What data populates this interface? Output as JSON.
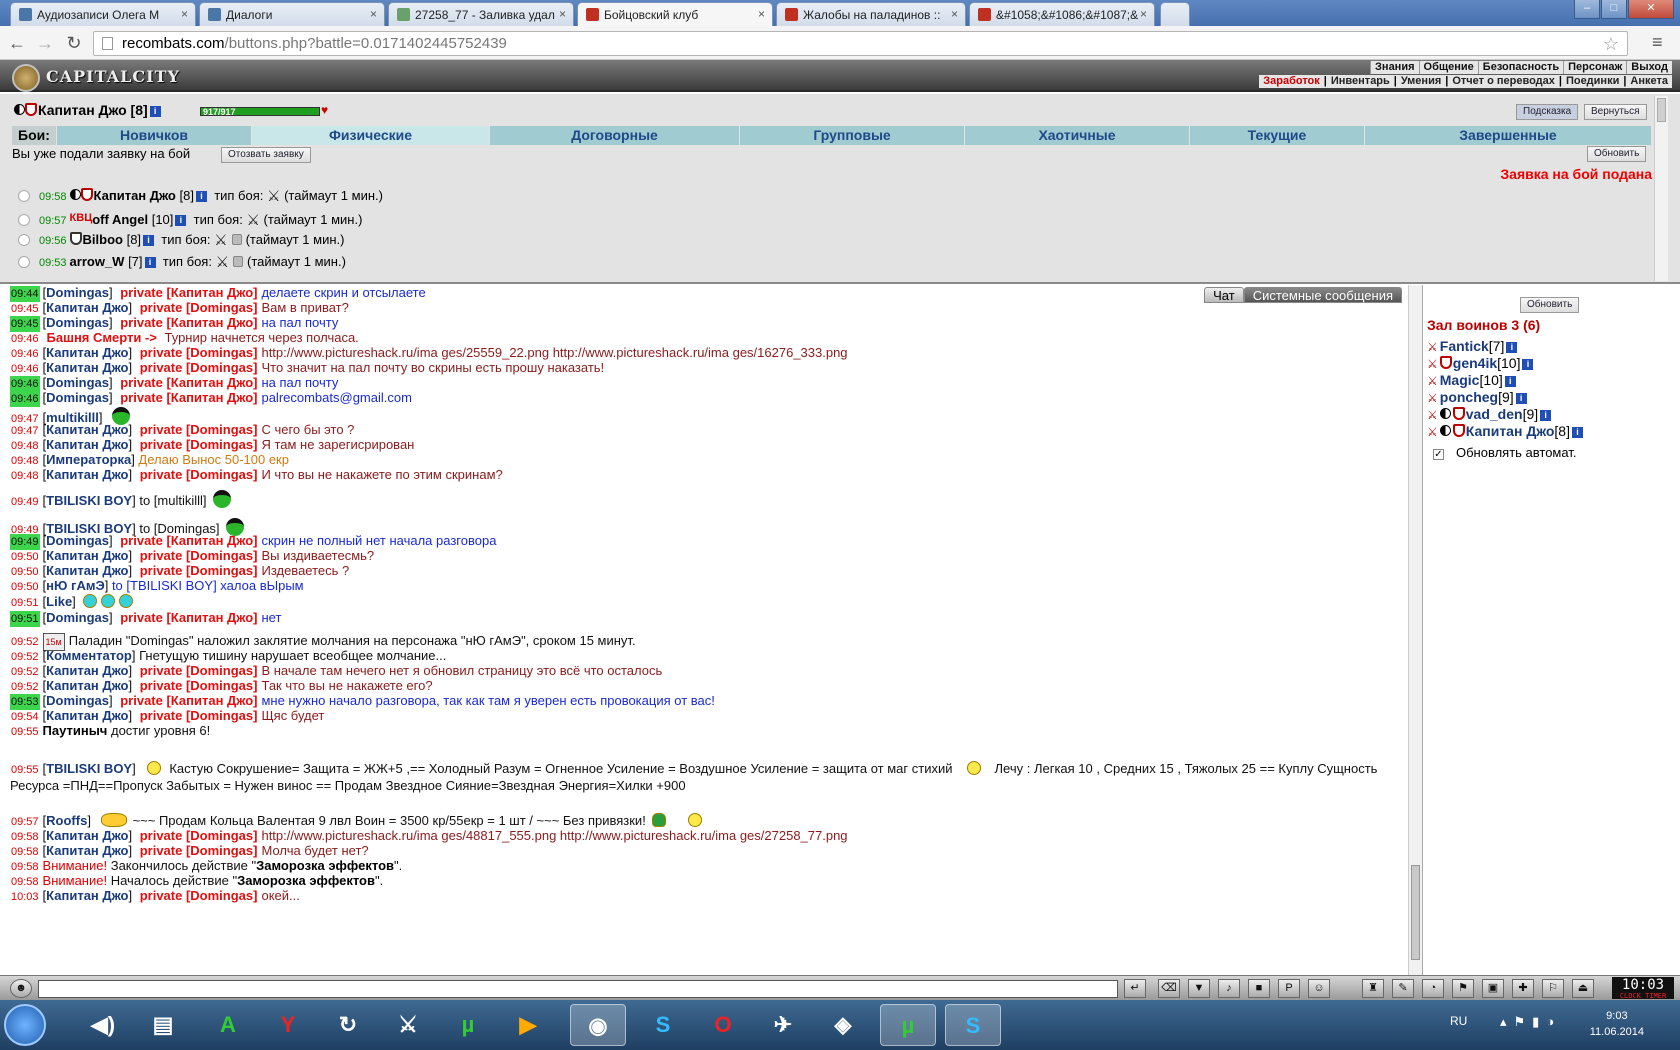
{
  "browser": {
    "tabs": [
      {
        "title": "Аудиозаписи Олега М",
        "color": "#4a76a8"
      },
      {
        "title": "Диалоги",
        "color": "#4a76a8"
      },
      {
        "title": "27258_77 - Заливка удал",
        "color": "#6aa06a"
      },
      {
        "title": "Бойцовский клуб",
        "color": "#c03020"
      },
      {
        "title": "Жалобы на паладинов ::",
        "color": "#c03020"
      },
      {
        "title": "&#1058;&#1086;&#1087;&",
        "color": "#c03020"
      }
    ],
    "url_host": "recombats.com",
    "url_path": "/buttons.php?battle=0.0171402445752439",
    "window_icons": [
      "minimize-icon",
      "maximize-icon",
      "close-icon"
    ]
  },
  "game": {
    "logo": "CAPITALCITY",
    "top_menu": [
      "Знания",
      "Общение",
      "Безопасность",
      "Персонаж",
      "Выход"
    ],
    "sub_menu": [
      "Заработок",
      "Инвентарь",
      "Умения",
      "Отчет о переводах",
      "Поединки",
      "Анкета"
    ],
    "character": {
      "name": "Капитан Джо",
      "level": "[8]",
      "hp": "917/917",
      "hp_fraction": 1.0
    },
    "hint_btn": "Подсказка",
    "back_btn": "Вернуться",
    "battles_label": "Бои:",
    "battle_tabs": [
      "Новичков",
      "Физические",
      "Договорные",
      "Групповые",
      "Хаотичные",
      "Текущие",
      "Завершенные"
    ],
    "applied_msg": "Вы уже подали заявку на бой",
    "withdraw_btn": "Отозвать заявку",
    "refresh_btn": "Обновить",
    "applied_red": "Заявка на бой подана",
    "bids": [
      {
        "time": "09:58",
        "name": "Капитан Джо",
        "level": "[8]",
        "type_label": "тип боя:",
        "timeout": "(таймаут 1 мин.)"
      },
      {
        "time": "09:57",
        "name": "off Angel",
        "level": "[10]",
        "badge": "КВЦ",
        "type_label": "тип боя:",
        "timeout": "(таймаут 1 мин.)"
      },
      {
        "time": "09:56",
        "name": "Bilboo",
        "level": "[8]",
        "type_label": "тип боя:",
        "timeout": "(таймаут 1 мин.)"
      },
      {
        "time": "09:53",
        "name": "arrow_W",
        "level": "[7]",
        "type_label": "тип боя:",
        "timeout": "(таймаут 1 мин.)"
      }
    ]
  },
  "chat": {
    "tabs": [
      "Чат",
      "Системные сообщения"
    ],
    "lines": [
      {
        "ts": "09:44",
        "g": true,
        "nick": "Domingas",
        "priv": "private [Капитан Джо]",
        "msg": "делаете скрин и отсылаете",
        "mc": "b"
      },
      {
        "ts": "09:45",
        "nick": "Капитан Джо",
        "priv": "private [Domingas]",
        "msg": "Вам в приват?",
        "mc": "r"
      },
      {
        "ts": "09:45",
        "g": true,
        "nick": "Domingas",
        "priv": "private [Капитан Джо]",
        "msg": "на пал почту",
        "mc": "b"
      },
      {
        "ts": "09:46",
        "sys": "Башня Смерти -> ",
        "msg": "Турнир начнется через полчаса.",
        "mc": "r"
      },
      {
        "ts": "09:46",
        "nick": "Капитан Джо",
        "priv": "private [Domingas]",
        "msg": "http://www.pictureshack.ru/ima ges/25559_22.png http://www.pictureshack.ru/ima ges/16276_333.png",
        "mc": "r"
      },
      {
        "ts": "09:46",
        "nick": "Капитан Джо",
        "priv": "private [Domingas]",
        "msg": "Что значит на пал почту во скрины есть прошу наказать!",
        "mc": "r"
      },
      {
        "ts": "09:46",
        "g": true,
        "nick": "Domingas",
        "priv": "private [Капитан Джо]",
        "msg": "на пал почту",
        "mc": "b"
      },
      {
        "ts": "09:46",
        "g": true,
        "nick": "Domingas",
        "priv": "private [Капитан Джо]",
        "msg": "palrecombats@gmail.com",
        "mc": "b"
      },
      {
        "ts": "09:47",
        "nick": "multikilll",
        "msg": "",
        "mc": "k",
        "hat": true
      },
      {
        "ts": "09:47",
        "nick": "Капитан Джо",
        "priv": "private [Domingas]",
        "msg": "С чего бы это ?",
        "mc": "r"
      },
      {
        "ts": "09:48",
        "nick": "Капитан Джо",
        "priv": "private [Domingas]",
        "msg": "Я там не зарегисрирован",
        "mc": "r"
      },
      {
        "ts": "09:48",
        "nick": "Императорка",
        "msg": "Делаю Вынос 50-100 екр",
        "mc": "o"
      },
      {
        "ts": "09:48",
        "nick": "Капитан Джо",
        "priv": "private [Domingas]",
        "msg": "И что вы не накажете по этим скринам?",
        "mc": "r"
      },
      {
        "ts": "09:49",
        "nick": "TBILISKI BOY",
        "msg": "to [multikilll]",
        "mc": "k",
        "hat": true
      },
      {
        "ts": "09:49",
        "nick": "TBILISKI BOY",
        "msg": "to [Domingas]",
        "mc": "k",
        "hat": true
      },
      {
        "ts": "09:49",
        "g": true,
        "nick": "Domingas",
        "priv": "private [Капитан Джо]",
        "msg": "скрин не полный нет начала разговора",
        "mc": "b"
      },
      {
        "ts": "09:50",
        "nick": "Капитан Джо",
        "priv": "private [Domingas]",
        "msg": "Вы издиваетесмь?",
        "mc": "r"
      },
      {
        "ts": "09:50",
        "nick": "Капитан Джо",
        "priv": "private [Domingas]",
        "msg": "Издеваетесь ?",
        "mc": "r"
      },
      {
        "ts": "09:50",
        "nick": "нЮ гАмЭ",
        "msg": "to [TBILISKI BOY] халоа вЫрым",
        "mc": "b"
      },
      {
        "ts": "09:51",
        "nick": "Like",
        "msg": "",
        "mc": "k",
        "smiles": 3
      },
      {
        "ts": "09:51",
        "g": true,
        "nick": "Domingas",
        "priv": "private [Капитан Джо]",
        "msg": "нет",
        "mc": "b"
      },
      {
        "ts": "09:52",
        "sysmsg": "Паладин \"Domingas\" наложил заклятие молчания на персонажа \"нЮ гАмЭ\", сроком 15 минут.",
        "silence": "15м"
      },
      {
        "ts": "09:52",
        "nick": "Комментатор",
        "msg": "Гнетущую тишину нарушает всеобщее молчание...",
        "mc": "k"
      },
      {
        "ts": "09:52",
        "nick": "Капитан Джо",
        "priv": "private [Domingas]",
        "msg": "В начале там нечего нет я обновил страницу это всё что осталось",
        "mc": "r"
      },
      {
        "ts": "09:52",
        "nick": "Капитан Джо",
        "priv": "private [Domingas]",
        "msg": "Так что вы не накажете его?",
        "mc": "r"
      },
      {
        "ts": "09:53",
        "g": true,
        "nick": "Domingas",
        "priv": "private [Капитан Джо]",
        "msg": "мне нужно начало разговора, так как там я уверен есть провокация от вас!",
        "mc": "b"
      },
      {
        "ts": "09:54",
        "nick": "Капитан Джо",
        "priv": "private [Domingas]",
        "msg": "Щяс будет",
        "mc": "r"
      },
      {
        "ts": "09:55",
        "plain_nick": "Паутиныч",
        "msg": "достиг уровня 6!",
        "mc": "k"
      },
      {
        "ts": "09:55",
        "nick": "TBILISKI BOY",
        "msg": "Кастую Сокрушение= Защита = ЖЖ+5 ,== Холодный Разум = Огненное Усиление = Воздушное Усиление = защита от маг стихий",
        "msg2": "Лечу : Легкая 10 , Средних 15 , Тяжолых 25 == Куплу Сущность Ресурса =ПНД==Пропуск Забытых = Нужен винос == Продам Звездное Сияние=Звездная Энергия=Хилки +900",
        "mc": "k"
      },
      {
        "ts": "09:57",
        "nick": "Rooffs",
        "msg": "~~~ Продам Кольца Валентая 9 лвл Воин = 3500 кр/55екр = 1 шт / ~~~ Без привязки!",
        "mc": "k"
      },
      {
        "ts": "09:58",
        "nick": "Капитан Джо",
        "priv": "private [Domingas]",
        "msg": "http://www.pictureshack.ru/ima ges/48817_555.png http://www.pictureshack.ru/ima ges/27258_77.png",
        "mc": "r"
      },
      {
        "ts": "09:58",
        "nick": "Капитан Джо",
        "priv": "private [Domingas]",
        "msg": "Молча будет нет?",
        "mc": "r"
      },
      {
        "ts": "09:58",
        "warn": "Внимание!",
        "msg": "Закончилось действие \"",
        "bold": "Заморозка эффектов",
        "tail": "\".",
        "mc": "k"
      },
      {
        "ts": "09:58",
        "warn": "Внимание!",
        "msg": "Началось действие \"",
        "bold": "Заморозка эффектов",
        "tail": "\".",
        "mc": "k"
      },
      {
        "ts": "10:03",
        "nick": "Капитан Джо",
        "priv": "private [Domingas]",
        "msg": "окей...",
        "mc": "r"
      }
    ]
  },
  "room": {
    "refresh_btn": "Обновить",
    "title": "Зал воинов 3 (6)",
    "players": [
      {
        "name": "Fantick",
        "level": "[7]"
      },
      {
        "name": "gen4ik",
        "level": "[10]"
      },
      {
        "name": "Magic",
        "level": "[10]"
      },
      {
        "name": "poncheg",
        "level": "[9]"
      },
      {
        "name": "vad_den",
        "level": "[9]"
      },
      {
        "name": "Капитан Джо",
        "level": "[8]"
      }
    ],
    "auto_refresh": "Обновлять автомат.",
    "auto_checked": true
  },
  "bottom": {
    "clock": "10:03",
    "clock_small": "CLOCK TIMER",
    "clock_sec": "06"
  },
  "taskbar": {
    "lang": "RU",
    "time": "9:03",
    "date": "11.06.2014"
  }
}
